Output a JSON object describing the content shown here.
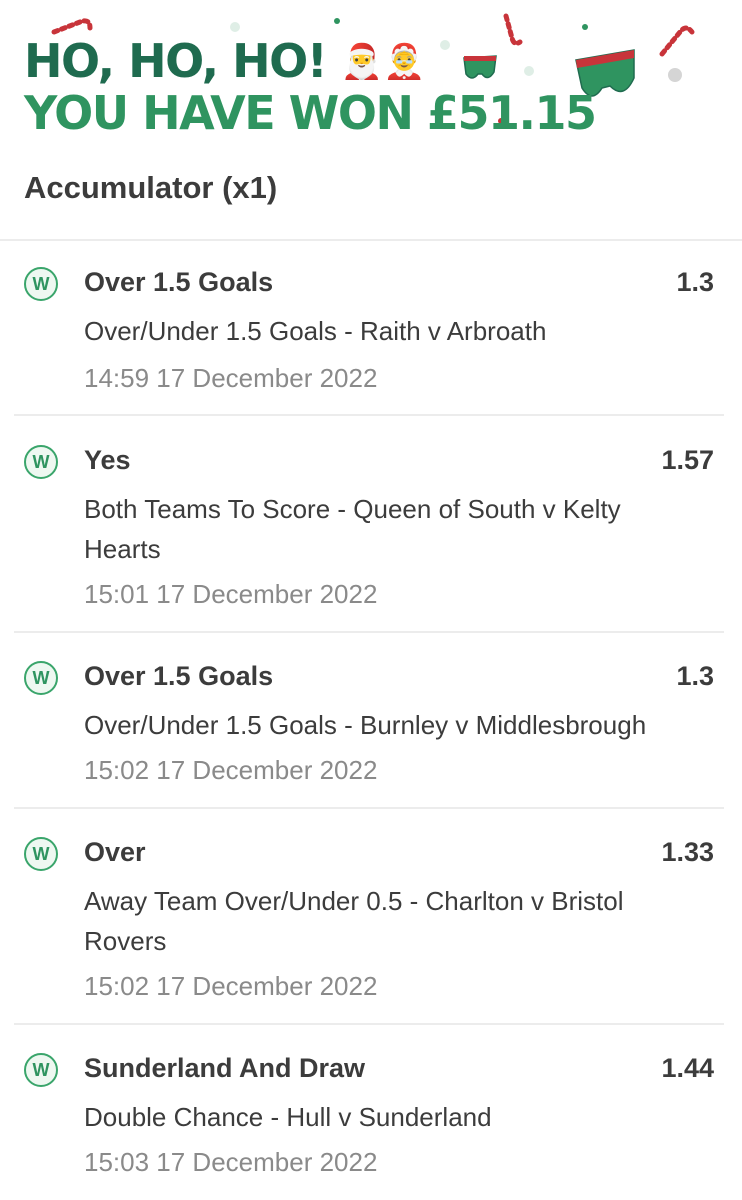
{
  "banner": {
    "line1": "HO, HO, HO!",
    "line1_emoji": "🎅🤶",
    "line2": "YOU HAVE WON £51.15",
    "colors": {
      "dark_green": "#1f6b4f",
      "green": "#2f9460",
      "red": "#c8343a"
    },
    "decorations": [
      "candy-cane-icon",
      "underpants-icon",
      "snow-dot"
    ]
  },
  "bet": {
    "title": "Accumulator (x1)"
  },
  "legs": [
    {
      "result": "W",
      "selection": "Over 1.5 Goals",
      "odds": "1.3",
      "market": "Over/Under 1.5 Goals - Raith v Arbroath",
      "time": "14:59 17 December 2022"
    },
    {
      "result": "W",
      "selection": "Yes",
      "odds": "1.57",
      "market": "Both Teams To Score - Queen of South v Kelty Hearts",
      "time": "15:01 17 December 2022"
    },
    {
      "result": "W",
      "selection": "Over 1.5 Goals",
      "odds": "1.3",
      "market": "Over/Under 1.5 Goals - Burnley v Middlesbrough",
      "time": "15:02 17 December 2022"
    },
    {
      "result": "W",
      "selection": "Over",
      "odds": "1.33",
      "market": "Away Team Over/Under 0.5 - Charlton v Bristol Rovers",
      "time": "15:02 17 December 2022"
    },
    {
      "result": "W",
      "selection": "Sunderland And Draw",
      "odds": "1.44",
      "market": "Double Chance - Hull v Sunderland",
      "time": "15:03 17 December 2022"
    }
  ]
}
